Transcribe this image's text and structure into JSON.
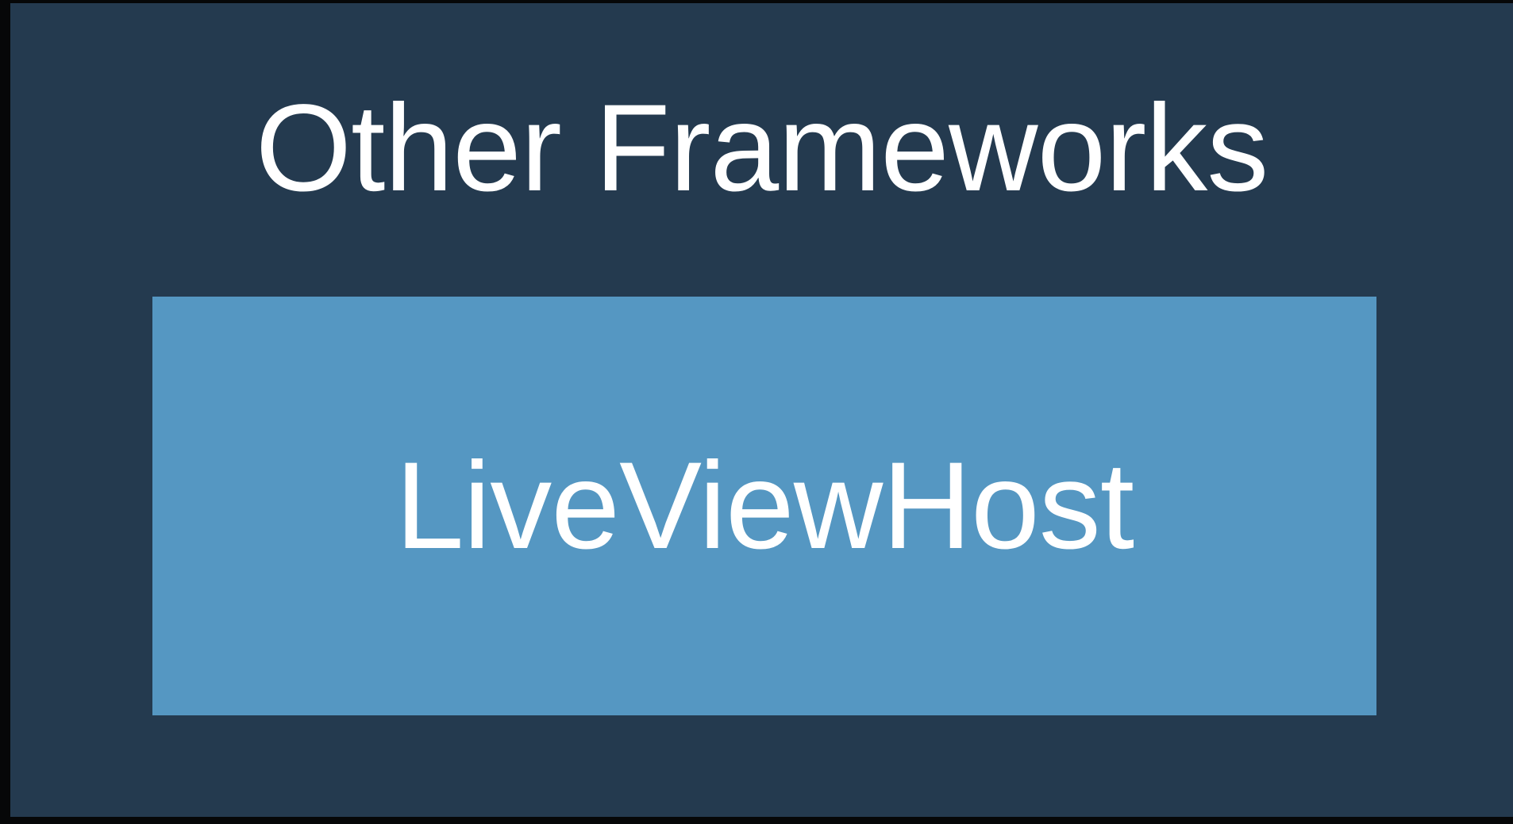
{
  "diagram": {
    "outer": {
      "title": "Other Frameworks",
      "fill_color": "#243a4f"
    },
    "inner": {
      "label": "LiveViewHost",
      "fill_color": "#5597c2"
    },
    "text_color": "#ffffff",
    "background_color": "#060708"
  }
}
